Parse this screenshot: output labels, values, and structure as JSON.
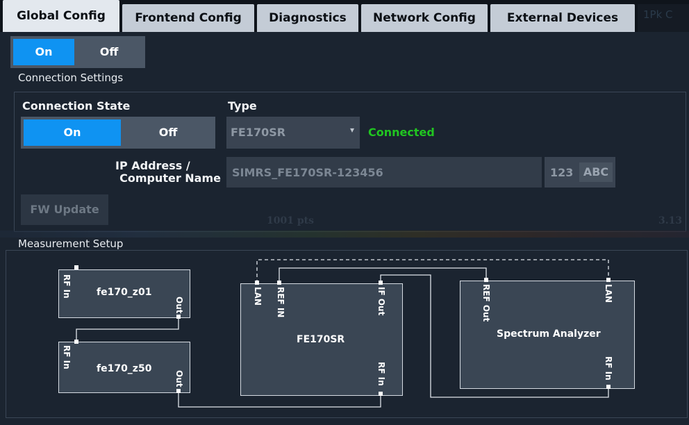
{
  "tabs": [
    {
      "label": "Global Config",
      "active": true
    },
    {
      "label": "Frontend Config",
      "active": false
    },
    {
      "label": "Diagnostics",
      "active": false
    },
    {
      "label": "Network Config",
      "active": false
    },
    {
      "label": "External Devices",
      "active": false
    }
  ],
  "ghost_tab_text": "1Pk C",
  "global_toggle": {
    "on_label": "On",
    "off_label": "Off",
    "state": "On"
  },
  "connection_settings": {
    "title": "Connection Settings",
    "state_label": "Connection State",
    "type_label": "Type",
    "state_toggle": {
      "on_label": "On",
      "off_label": "Off",
      "state": "On"
    },
    "type_value": "FE170SR",
    "status": "Connected",
    "status_color": "#21c521",
    "ip_label_line1": "IP Address /",
    "ip_label_line2": "Computer Name",
    "ip_value": "SIMRS_FE170SR-123456",
    "keypad_num": "123",
    "keypad_abc": "ABC",
    "fw_update_label": "FW Update"
  },
  "background_trace": {
    "points_text": "1001 pts",
    "right_value": "3.13"
  },
  "measurement_setup": {
    "title": "Measurement Setup",
    "blocks": {
      "z01": {
        "name": "fe170_z01",
        "in": "RF In",
        "out": "Out"
      },
      "z50": {
        "name": "fe170_z50",
        "in": "RF In",
        "out": "Out"
      },
      "fe": {
        "name": "FE170SR",
        "lan": "LAN",
        "ref_in": "REF IN",
        "if_out": "IF Out",
        "rf_in": "RF In"
      },
      "sa": {
        "name": "Spectrum Analyzer",
        "ref_out": "REF Out",
        "lan": "LAN",
        "rf_in": "RF In"
      }
    }
  },
  "colors": {
    "accent": "#0f93f2",
    "panel": "#1b2430",
    "block": "#3a4654"
  }
}
